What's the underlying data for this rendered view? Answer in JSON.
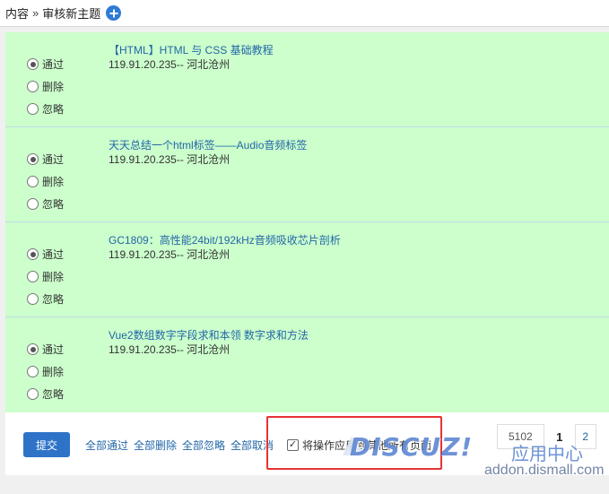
{
  "breadcrumb": {
    "root": "内容",
    "separator": "»",
    "current": "审核新主题"
  },
  "radio_labels": {
    "pass": "通过",
    "delete": "删除",
    "ignore": "忽略"
  },
  "items": [
    {
      "title": "【HTML】HTML 与 CSS 基础教程",
      "ip": "119.91.20.235-- 河北沧州",
      "selected": "pass"
    },
    {
      "title": "天天总结一个html标签——Audio音频标签",
      "ip": "119.91.20.235-- 河北沧州",
      "selected": "pass"
    },
    {
      "title": "GC1809：高性能24bit/192kHz音频吸收芯片剖析",
      "ip": "119.91.20.235-- 河北沧州",
      "selected": "pass"
    },
    {
      "title": "Vue2数组数字字段求和本领 数字求和方法",
      "ip": "119.91.20.235-- 河北沧州",
      "selected": "pass"
    }
  ],
  "footer": {
    "submit_label": "提交",
    "bulk_links": [
      "全部通过",
      "全部删除",
      "全部忽略",
      "全部取消"
    ],
    "apply_all_label": "将操作应用到其他所有页面",
    "apply_all_checked": true
  },
  "pager": {
    "total": "5102",
    "current_page": "1",
    "next_page": "2"
  },
  "watermark": {
    "logo": "DISCUZ!",
    "cn": "应用中心",
    "url": "addon.dismall.com"
  },
  "colors": {
    "item_bg": "#ccffcc",
    "link": "#2366a8",
    "button": "#2f73c9",
    "highlight": "#e53333"
  }
}
